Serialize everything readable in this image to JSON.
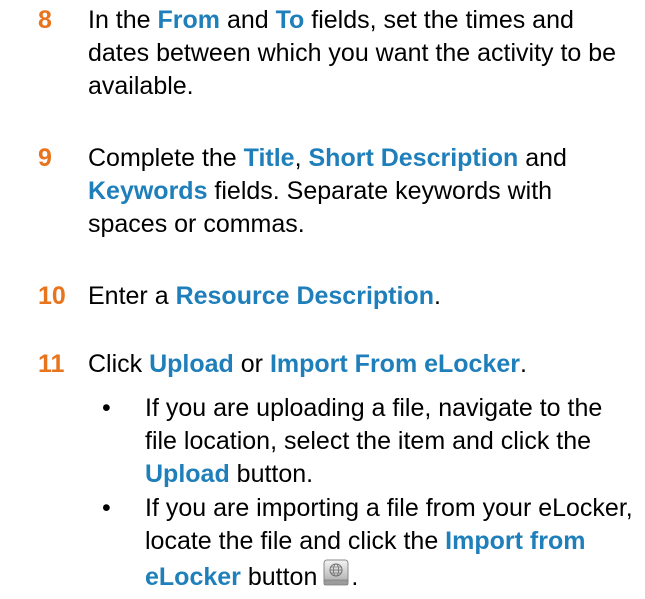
{
  "colors": {
    "step_number": "#e8741e",
    "highlight": "#1f7fba",
    "text": "#000000"
  },
  "steps": [
    {
      "number": "8",
      "parts": [
        "In the ",
        "From",
        " and ",
        "To",
        " fields, set the times and dates between which you want the activity to be available."
      ]
    },
    {
      "number": "9",
      "parts": [
        "Complete the ",
        "Title",
        ", ",
        "Short Description",
        " and ",
        "Keywords",
        " fields. Separate keywords with spaces or commas."
      ]
    },
    {
      "number": "10",
      "parts": [
        "Enter a ",
        "Resource Description",
        "."
      ]
    },
    {
      "number": "11",
      "parts": [
        "Click ",
        "Upload",
        " or ",
        "Import From eLocker",
        "."
      ]
    }
  ],
  "bullets": [
    {
      "marker": "•",
      "parts": [
        "If you are uploading a file, navigate to the file location, select the item and click the ",
        "Upload",
        " button."
      ]
    },
    {
      "marker": "•",
      "parts": [
        "If you are importing a file from your eLocker, locate the file and click the ",
        "Import from eLocker",
        " button",
        "."
      ]
    }
  ],
  "icons": {
    "import_button_icon": "globe-drive-icon"
  }
}
